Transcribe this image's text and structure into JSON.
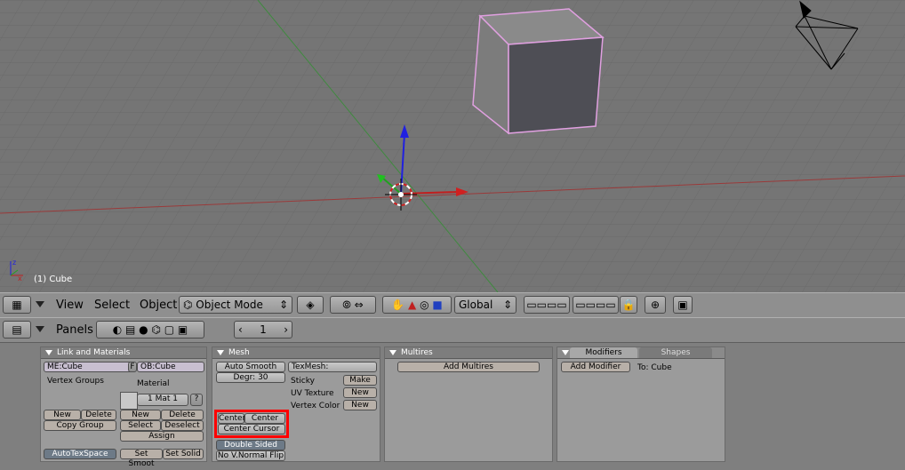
{
  "viewport": {
    "object_label": "(1) Cube"
  },
  "header3d": {
    "menus": [
      "View",
      "Select",
      "Object"
    ],
    "mode": "Object Mode",
    "orientation": "Global"
  },
  "buttons_header": {
    "panels_label": "Panels",
    "frame": "1"
  },
  "link_materials": {
    "title": "Link and Materials",
    "mesh_name": "ME:Cube",
    "f_label": "F",
    "ob_name": "OB:Cube",
    "vertex_groups": "Vertex Groups",
    "material": "Material",
    "mat_index": "1 Mat 1",
    "question": "?",
    "vg_new": "New",
    "vg_delete": "Delete",
    "copy_group": "Copy Group",
    "mat_new": "New",
    "mat_delete": "Delete",
    "mat_select": "Select",
    "mat_deselect": "Deselect",
    "assign": "Assign",
    "autotexspace": "AutoTexSpace",
    "set_smooth": "Set Smoot",
    "set_solid": "Set Solid"
  },
  "mesh": {
    "title": "Mesh",
    "auto_smooth": "Auto Smooth",
    "degr": "Degr: 30",
    "texmesh": "TexMesh:",
    "sticky": "Sticky",
    "make": "Make",
    "uv_texture": "UV Texture",
    "uv_new": "New",
    "vertex_color": "Vertex Color",
    "vc_new": "New",
    "center": "Center",
    "center_new": "Center New",
    "center_cursor": "Center Cursor",
    "double_sided": "Double Sided",
    "no_vnormal_flip": "No V.Normal Flip"
  },
  "multires": {
    "title": "Multires",
    "add_multires": "Add Multires"
  },
  "modifiers": {
    "tab_modifiers": "Modifiers",
    "tab_shapes": "Shapes",
    "add_modifier": "Add Modifier",
    "to_label": "To: Cube"
  },
  "colors": {
    "highlight": "#ff0000",
    "selection_outline": "#e0a0e0",
    "x_axis": "#c02020",
    "y_axis": "#20a020",
    "z_axis": "#2020e0"
  }
}
